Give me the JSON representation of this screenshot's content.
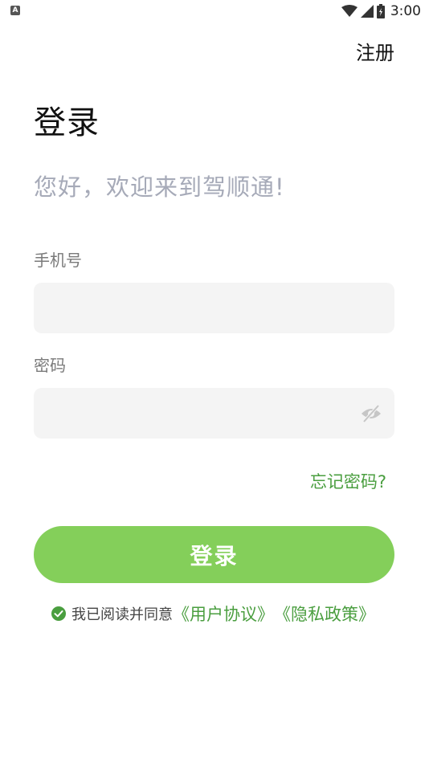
{
  "status_bar": {
    "left_icon_letter": "A",
    "time": "3:00"
  },
  "header": {
    "register_label": "注册"
  },
  "main": {
    "title": "登录",
    "welcome": "您好，欢迎来到驾顺通!",
    "phone": {
      "label": "手机号",
      "value": "",
      "placeholder": ""
    },
    "password": {
      "label": "密码",
      "value": "",
      "placeholder": ""
    },
    "forgot_label": "忘记密码?",
    "login_label": "登录",
    "agreement": {
      "prefix": "我已阅读并同意",
      "user_agreement": "《用户协议》",
      "privacy_policy": "《隐私政策》",
      "checked": true
    }
  },
  "colors": {
    "accent_green": "#84cf5a",
    "link_green": "#4a9e3f",
    "welcome_gray": "#a6aab8",
    "input_bg": "#f4f4f4"
  },
  "icons": {
    "wifi": "wifi-icon",
    "signal": "signal-icon",
    "battery": "battery-icon",
    "eye": "eye-off-icon",
    "check": "check-circle-icon"
  }
}
